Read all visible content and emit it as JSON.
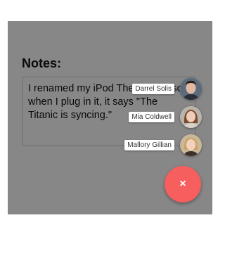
{
  "notes": {
    "heading": "Notes:",
    "value": "I renamed my iPod The Titanic, so when I plug in it, it says \"The Titanic is syncing.\""
  },
  "contacts": [
    {
      "name": "Darrel Solis",
      "avatar_icon": "avatar-photo-man-dark-hair"
    },
    {
      "name": "Mia Coldwell",
      "avatar_icon": "avatar-photo-woman-brown-hair"
    },
    {
      "name": "Mallory Gillian",
      "avatar_icon": "avatar-photo-woman-blonde-hair"
    }
  ],
  "fab": {
    "icon": "×",
    "icon_name": "close-icon",
    "color": "#f75e5e"
  },
  "colors": {
    "overlay": "rgba(0,0,0,0.47)",
    "label_bg": "#ffffff"
  }
}
